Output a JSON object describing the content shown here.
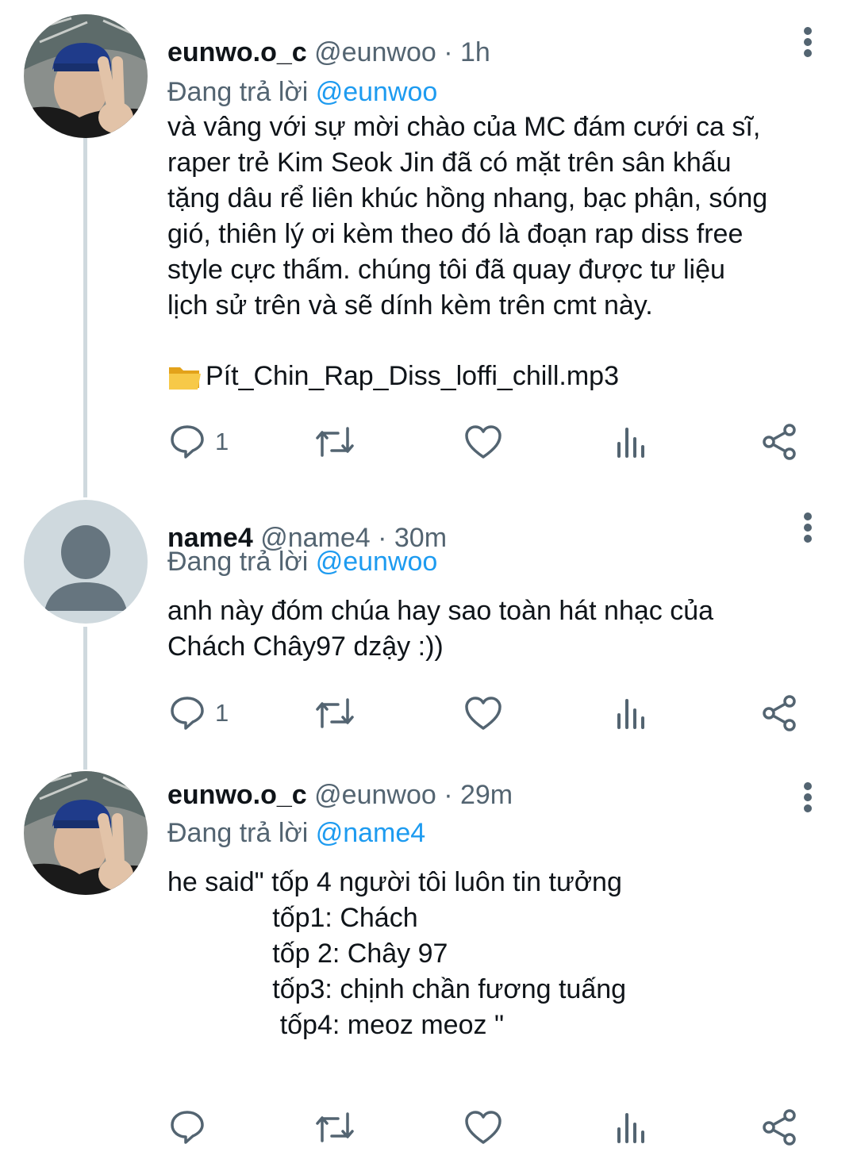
{
  "colors": {
    "text": "#0f1419",
    "muted": "#536471",
    "link": "#1d9bf0",
    "thread_line": "#cfd9de"
  },
  "tweets": [
    {
      "name": "eunwo.o_c",
      "meta": "@eunwoo · 1h",
      "reply_prefix": "Đang trả lời",
      "reply_to": "@eunwoo",
      "text": "và vâng với sự mời chào của MC đám cưới ca sĩ,\nraper trẻ Kim Seok Jin đã có mặt trên sân khấu\ntặng dâu rể liên khúc hồng nhang, bạc phận, sóng\ngió, thiên lý ơi kèm theo đó là đoạn rap diss free\nstyle cực thấm. chúng tôi đã quay được tư liệu\nlịch sử trên và sẽ dính kèm trên cmt này.",
      "attachment": "Pít_Chin_Rap_Diss_loffi_chill.mp3",
      "reply_count": "1"
    },
    {
      "name": "name4",
      "meta": "@name4 · 30m",
      "reply_prefix": "Đang trả lời",
      "reply_to": "@eunwoo",
      "text": "anh này đóm chúa hay sao toàn hát nhạc của\nChách Chây97 dzậy :))",
      "reply_count": "1"
    },
    {
      "name": "eunwo.o_c",
      "meta": "@eunwoo · 29m",
      "reply_prefix": "Đang trả lời",
      "reply_to": "@name4",
      "text": "he said\" tốp 4 người tôi luôn tin tưởng\n              tốp1: Chách\n              tốp 2: Chây 97\n              tốp3: chịnh chần fương tuấng\n               tốp4: meoz meoz \"",
      "reply_count": ""
    }
  ],
  "icons": [
    "reply-icon",
    "retweet-icon",
    "like-icon",
    "views-icon",
    "share-icon",
    "more-icon",
    "folder-icon"
  ]
}
